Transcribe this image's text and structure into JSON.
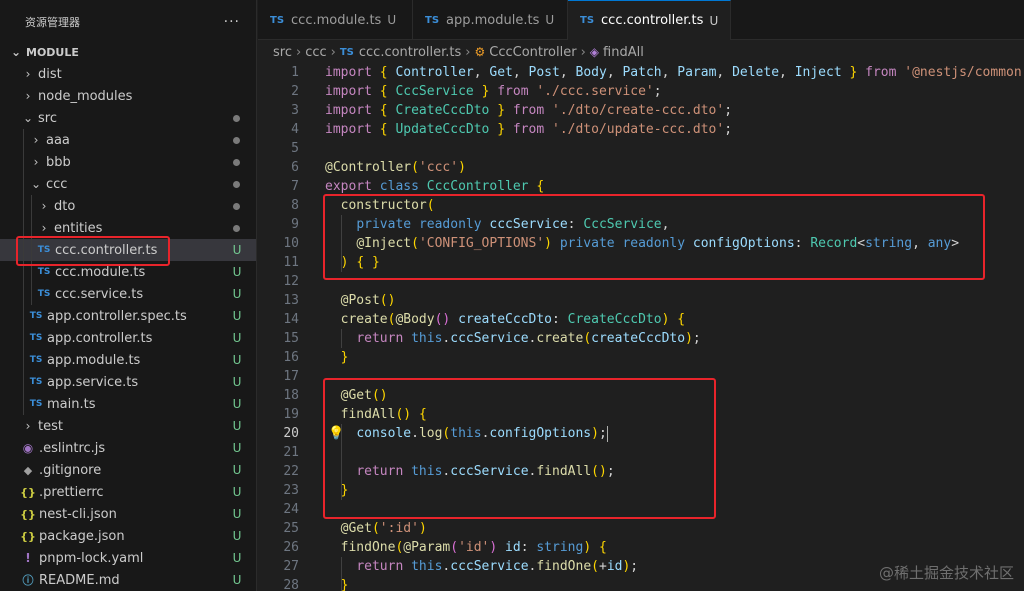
{
  "explorer": {
    "title": "资源管理器",
    "more": "···",
    "section": "MODULE",
    "items": [
      {
        "label": "dist",
        "type": "folder",
        "chev": "›",
        "indent": 0
      },
      {
        "label": "node_modules",
        "type": "folder",
        "chev": "›",
        "indent": 0
      },
      {
        "label": "src",
        "type": "folder-open",
        "chev": "⌄",
        "indent": 0,
        "dot": true
      },
      {
        "label": "aaa",
        "type": "folder",
        "chev": "›",
        "indent": 1,
        "dot": true
      },
      {
        "label": "bbb",
        "type": "folder",
        "chev": "›",
        "indent": 1,
        "dot": true
      },
      {
        "label": "ccc",
        "type": "folder-open",
        "chev": "⌄",
        "indent": 1,
        "dot": true
      },
      {
        "label": "dto",
        "type": "folder",
        "chev": "›",
        "indent": 2,
        "dot": true
      },
      {
        "label": "entities",
        "type": "folder",
        "chev": "›",
        "indent": 2,
        "dot": true
      },
      {
        "label": "ccc.controller.ts",
        "type": "ts",
        "indent": 2,
        "status": "U",
        "selected": true
      },
      {
        "label": "ccc.module.ts",
        "type": "ts",
        "indent": 2,
        "status": "U"
      },
      {
        "label": "ccc.service.ts",
        "type": "ts",
        "indent": 2,
        "status": "U"
      },
      {
        "label": "app.controller.spec.ts",
        "type": "ts",
        "indent": 1,
        "status": "U"
      },
      {
        "label": "app.controller.ts",
        "type": "ts",
        "indent": 1,
        "status": "U"
      },
      {
        "label": "app.module.ts",
        "type": "ts",
        "indent": 1,
        "status": "U"
      },
      {
        "label": "app.service.ts",
        "type": "ts",
        "indent": 1,
        "status": "U"
      },
      {
        "label": "main.ts",
        "type": "ts",
        "indent": 1,
        "status": "U"
      },
      {
        "label": "test",
        "type": "folder",
        "chev": "›",
        "indent": 0,
        "status": "U"
      },
      {
        "label": ".eslintrc.js",
        "type": "eslint",
        "indent": 0,
        "status": "U"
      },
      {
        "label": ".gitignore",
        "type": "git",
        "indent": 0,
        "status": "U"
      },
      {
        "label": ".prettierrc",
        "type": "json",
        "indent": 0,
        "status": "U"
      },
      {
        "label": "nest-cli.json",
        "type": "json",
        "indent": 0,
        "status": "U"
      },
      {
        "label": "package.json",
        "type": "json",
        "indent": 0,
        "status": "U"
      },
      {
        "label": "pnpm-lock.yaml",
        "type": "yaml",
        "indent": 0,
        "status": "U"
      },
      {
        "label": "README.md",
        "type": "md",
        "indent": 0,
        "status": "U"
      }
    ]
  },
  "tabs": [
    {
      "label": "ccc.module.ts",
      "badge": "TS",
      "status": "U",
      "active": false
    },
    {
      "label": "app.module.ts",
      "badge": "TS",
      "status": "U",
      "active": false
    },
    {
      "label": "ccc.controller.ts",
      "badge": "TS",
      "status": "U",
      "active": true
    }
  ],
  "breadcrumb": {
    "parts": [
      "src",
      "ccc",
      "ccc.controller.ts",
      "CccController",
      "findAll"
    ],
    "separator": "›",
    "badge": "TS"
  },
  "editor": {
    "current_line": 20,
    "lines": [
      "import { Controller, Get, Post, Body, Patch, Param, Delete, Inject } from '@nestjs/common';",
      "import { CccService } from './ccc.service';",
      "import { CreateCccDto } from './dto/create-ccc.dto';",
      "import { UpdateCccDto } from './dto/update-ccc.dto';",
      "",
      "@Controller('ccc')",
      "export class CccController {",
      "  constructor(",
      "    private readonly cccService: CccService,",
      "    @Inject('CONFIG_OPTIONS') private readonly configOptions: Record<string, any>",
      "  ) { }",
      "",
      "  @Post()",
      "  create(@Body() createCccDto: CreateCccDto) {",
      "    return this.cccService.create(createCccDto);",
      "  }",
      "",
      "  @Get()",
      "  findAll() {",
      "    console.log(this.configOptions);",
      "",
      "    return this.cccService.findAll();",
      "  }",
      "",
      "  @Get(':id')",
      "  findOne(@Param('id') id: string) {",
      "    return this.cccService.findOne(+id);",
      "  }"
    ]
  },
  "watermark": "@稀土掘金技术社区",
  "colors": {
    "annotation": "#e8242b",
    "accent": "#0078d4",
    "untracked": "#73c991"
  }
}
